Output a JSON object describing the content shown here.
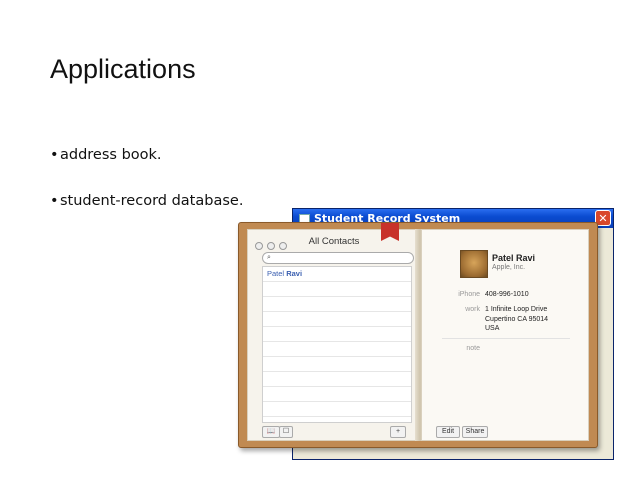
{
  "slide": {
    "title": "Applications",
    "bullets": [
      "address book.",
      "student-record database."
    ]
  },
  "xp_window": {
    "title": "Student Record System",
    "close_glyph": "✕"
  },
  "address_book": {
    "header": "All Contacts",
    "search_glyph": "⌕",
    "contacts": [
      {
        "first": "Patel",
        "last": "Ravi"
      }
    ],
    "bottom_buttons": {
      "groups": "📖",
      "card": "☐",
      "add": "+"
    },
    "card": {
      "name": "Patel Ravi",
      "company": "Apple, Inc.",
      "phone_label": "iPhone",
      "phone_value": "408-996-1010",
      "work_label": "work",
      "work_address_line1": "1 Infinite Loop Drive",
      "work_address_line2": "Cupertino CA 95014",
      "work_address_line3": "USA",
      "note_label": "note",
      "edit_label": "Edit",
      "share_label": "Share"
    }
  }
}
